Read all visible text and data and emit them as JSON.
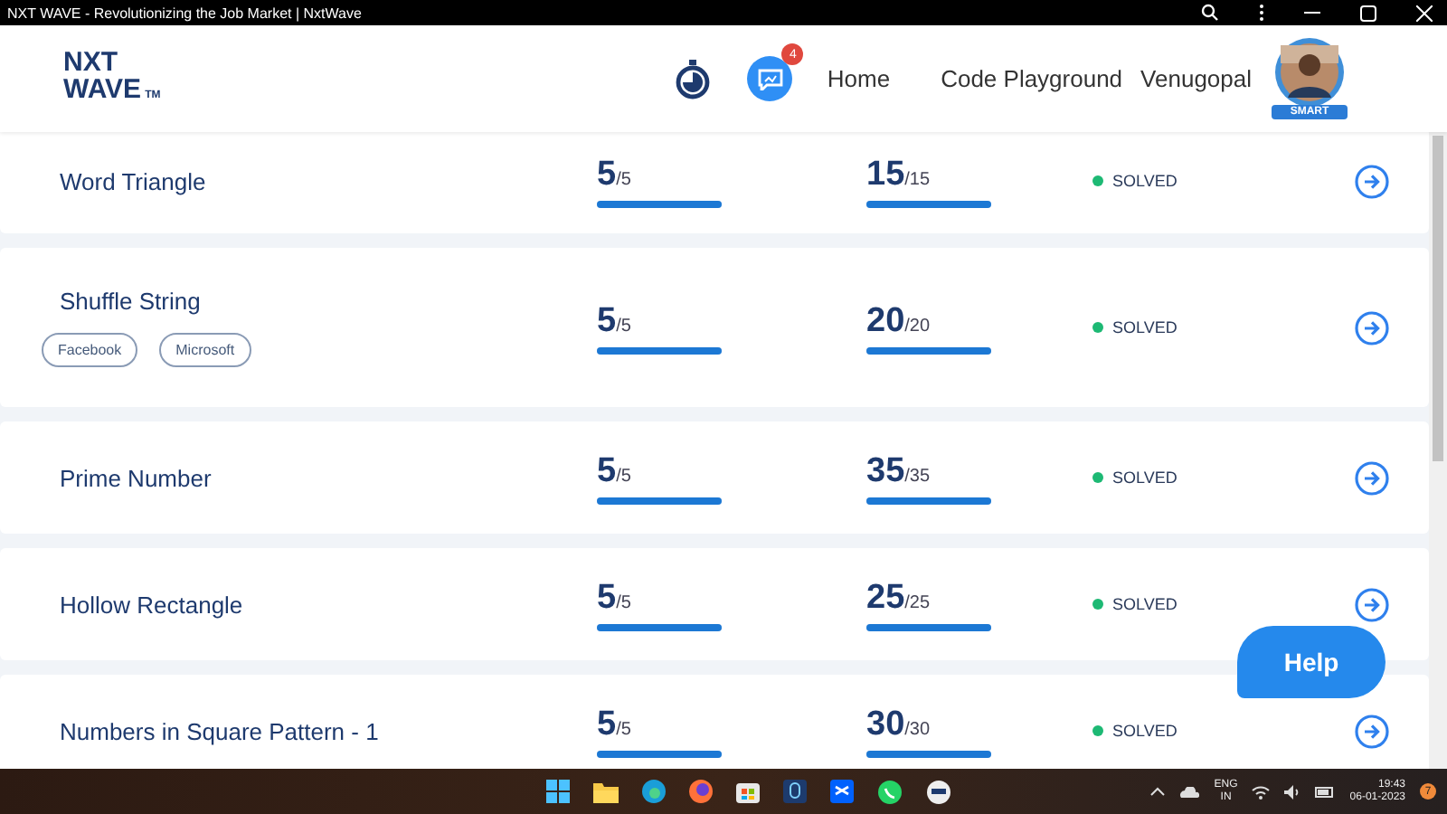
{
  "window": {
    "title": "NXT WAVE - Revolutionizing the Job Market | NxtWave"
  },
  "header": {
    "logo": {
      "line1": "NXT",
      "line2": "WAVE",
      "mark": "TM"
    },
    "notification_count": "4",
    "nav": [
      "Home",
      "Code Playground",
      "Venugopal"
    ],
    "avatar_ribbon": "SMART"
  },
  "problems": [
    {
      "name": "Word Triangle",
      "score": {
        "value": "5",
        "max": "/5",
        "level": 1
      },
      "points": {
        "value": "15",
        "max": "/15",
        "level": 1
      },
      "status": {
        "label": "SOLVED",
        "color": "#1db974"
      }
    },
    {
      "name": "Shuffle String",
      "tags": [
        "Facebook",
        "Microsoft"
      ],
      "score": {
        "value": "5",
        "max": "/5",
        "level": 1
      },
      "points": {
        "value": "20",
        "max": "/20",
        "level": 1
      },
      "status": {
        "label": "SOLVED",
        "color": "#1db974"
      }
    },
    {
      "name": "Prime Number",
      "score": {
        "value": "5",
        "max": "/5",
        "level": 1
      },
      "points": {
        "value": "35",
        "max": "/35",
        "level": 1
      },
      "status": {
        "label": "SOLVED",
        "color": "#1db974"
      }
    },
    {
      "name": "Hollow Rectangle",
      "score": {
        "value": "5",
        "max": "/5",
        "level": 1
      },
      "points": {
        "value": "25",
        "max": "/25",
        "level": 1
      },
      "status": {
        "label": "SOLVED",
        "color": "#1db974"
      }
    },
    {
      "name": "Numbers in Square Pattern - 1",
      "score": {
        "value": "5",
        "max": "/5",
        "level": 1
      },
      "points": {
        "value": "30",
        "max": "/30",
        "level": 1
      },
      "status": {
        "label": "SOLVED",
        "color": "#1db974"
      }
    }
  ],
  "help_button": "Help",
  "taskbar": {
    "language": "ENG",
    "region": "IN",
    "time": "19:43",
    "date": "06-01-2023",
    "notification_count": "7"
  }
}
